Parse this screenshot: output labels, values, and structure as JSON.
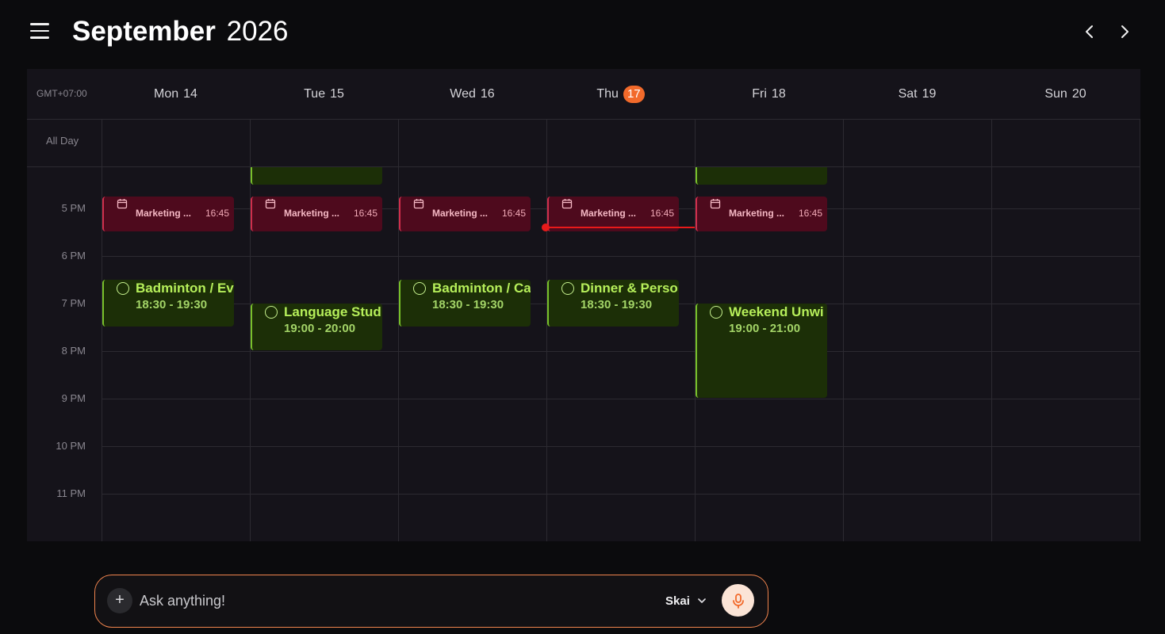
{
  "header": {
    "month": "September",
    "year": "2026"
  },
  "calendar": {
    "timezone": "GMT+07:00",
    "all_day_label": "All Day",
    "days": [
      {
        "name": "Mon",
        "num": "14",
        "today": false
      },
      {
        "name": "Tue",
        "num": "15",
        "today": false
      },
      {
        "name": "Wed",
        "num": "16",
        "today": false
      },
      {
        "name": "Thu",
        "num": "17",
        "today": true
      },
      {
        "name": "Fri",
        "num": "18",
        "today": false
      },
      {
        "name": "Sat",
        "num": "19",
        "today": false
      },
      {
        "name": "Sun",
        "num": "20",
        "today": false
      }
    ],
    "hours": [
      "5 PM",
      "6 PM",
      "7 PM",
      "8 PM",
      "9 PM",
      "10 PM",
      "11 PM"
    ],
    "meetings": [
      {
        "title": "Marketing ...",
        "time": "16:45",
        "day": 0
      },
      {
        "title": "Marketing ...",
        "time": "16:45",
        "day": 1
      },
      {
        "title": "Marketing ...",
        "time": "16:45",
        "day": 2
      },
      {
        "title": "Marketing ...",
        "time": "16:45",
        "day": 3
      },
      {
        "title": "Marketing ...",
        "time": "16:45",
        "day": 4
      }
    ],
    "tasks": [
      {
        "title": "Badminton / Ev",
        "time": "18:30 - 19:30",
        "day": 0
      },
      {
        "title": "Language Stud",
        "time": "19:00 - 20:00",
        "day": 1
      },
      {
        "title": "Badminton / Ca",
        "time": "18:30 - 19:30",
        "day": 2
      },
      {
        "title": "Dinner & Perso",
        "time": "18:30 - 19:30",
        "day": 3
      },
      {
        "title": "Weekend Unwi",
        "time": "19:00 - 21:00",
        "day": 4
      }
    ]
  },
  "chat": {
    "placeholder": "Ask anything!",
    "model": "Skai",
    "accent_color": "#f26a2b"
  }
}
